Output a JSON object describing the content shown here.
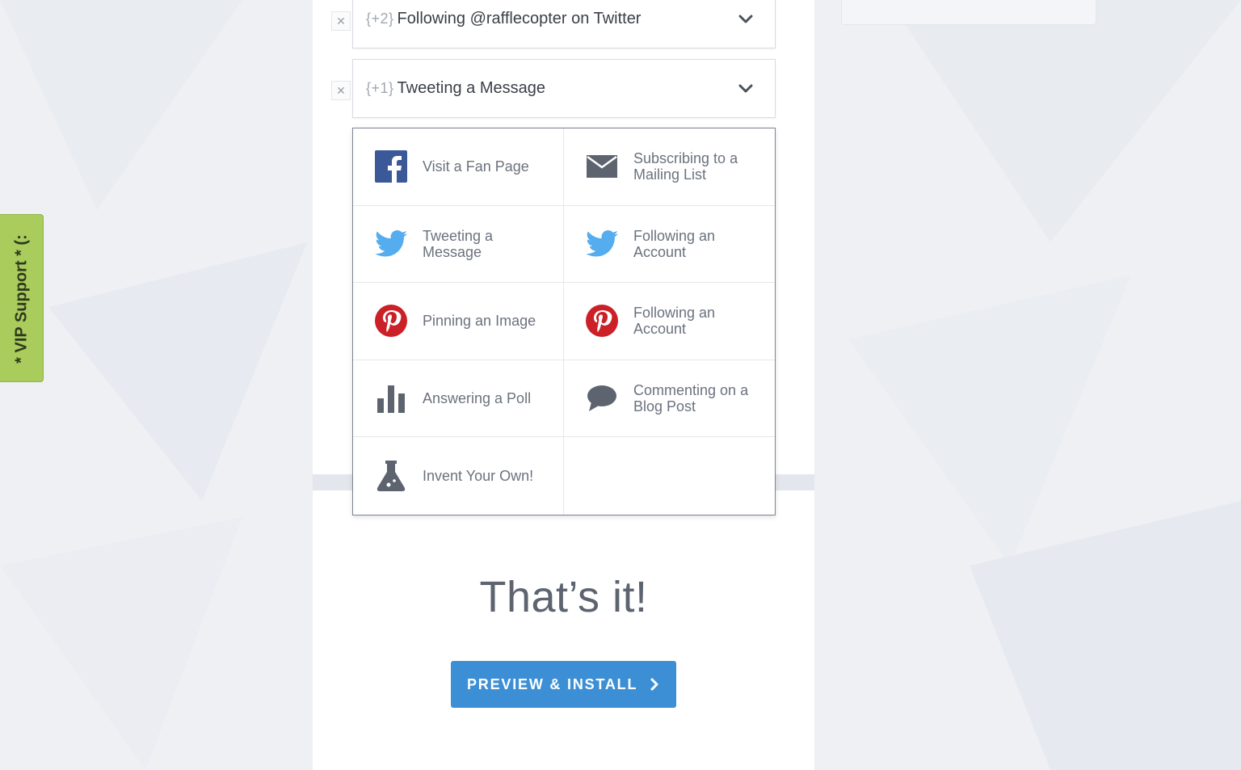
{
  "entries": [
    {
      "points": "{+2}",
      "title": "Following @rafflecopter on Twitter"
    },
    {
      "points": "{+1}",
      "title": "Tweeting a Message"
    }
  ],
  "menu": {
    "items": [
      {
        "label": "Visit a Fan Page",
        "icon": "facebook-icon"
      },
      {
        "label": "Subscribing to a Mailing List",
        "icon": "envelope-icon"
      },
      {
        "label": "Tweeting a Message",
        "icon": "twitter-icon"
      },
      {
        "label": "Following an Account",
        "icon": "twitter-icon"
      },
      {
        "label": "Pinning an Image",
        "icon": "pinterest-icon"
      },
      {
        "label": "Following an Account",
        "icon": "pinterest-icon"
      },
      {
        "label": "Answering a Poll",
        "icon": "bar-chart-icon"
      },
      {
        "label": "Commenting on a Blog Post",
        "icon": "speech-bubble-icon"
      },
      {
        "label": "Invent Your Own!",
        "icon": "flask-icon"
      }
    ]
  },
  "headline": "That’s it!",
  "cta": {
    "label": "PREVIEW & INSTALL"
  },
  "vip_tab": {
    "label": "* VIP Support * (:"
  },
  "colors": {
    "accent": "#3d8fd5",
    "facebook": "#3b5998",
    "twitter": "#55acee",
    "pinterest": "#cb2027",
    "vip": "#a9cc5c"
  }
}
